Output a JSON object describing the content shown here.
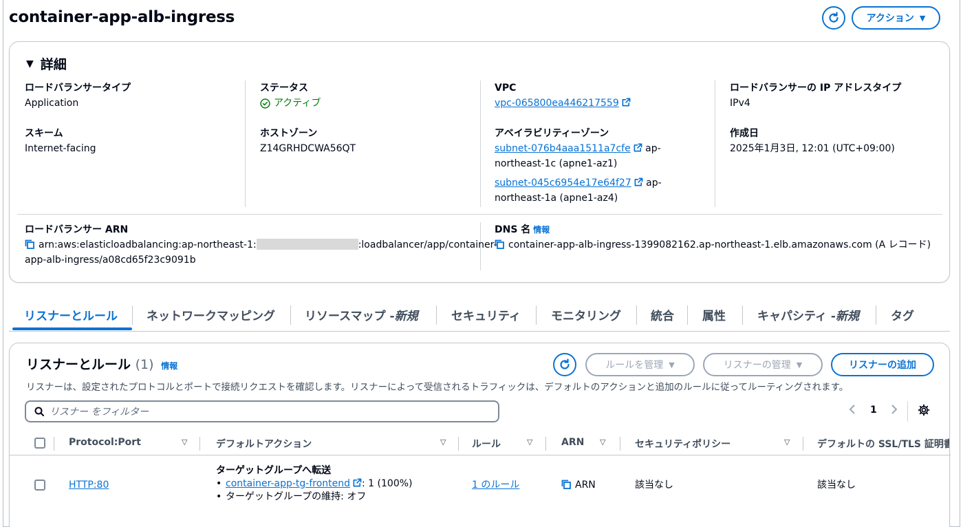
{
  "header": {
    "title": "container-app-alb-ingress",
    "actions_label": "アクション"
  },
  "details": {
    "heading": "詳細",
    "lb_type_label": "ロードバランサータイプ",
    "lb_type_value": "Application",
    "scheme_label": "スキーム",
    "scheme_value": "Internet-facing",
    "status_label": "ステータス",
    "status_value": "アクティブ",
    "hosted_zone_label": "ホストゾーン",
    "hosted_zone_value": "Z14GRHDCWA56QT",
    "vpc_label": "VPC",
    "vpc_value": "vpc-065800ea446217559",
    "az_label": "アベイラビリティーゾーン",
    "subnets": [
      {
        "id": "subnet-076b4aaa1511a7cfe",
        "suffix": " ap-",
        "zone": "northeast-1c (apne1-az1)"
      },
      {
        "id": "subnet-045c6954e17e64f27",
        "suffix": " ap-",
        "zone": "northeast-1a (apne1-az4)"
      }
    ],
    "ip_type_label": "ロードバランサーの IP アドレスタイプ",
    "ip_type_value": "IPv4",
    "created_label": "作成日",
    "created_value": "2025年1月3日, 12:01 (UTC+09:00)",
    "arn_label": "ロードバランサー ARN",
    "arn_part1": "arn:aws:elasticloadbalancing:ap-northeast-1:",
    "arn_part2": ":loadbalancer/app/container-",
    "arn_part3": "app-alb-ingress/a08cd65f23c9091b",
    "dns_label": "DNS 名",
    "info_label": "情報",
    "dns_value": "container-app-alb-ingress-1399082162.ap-northeast-1.elb.amazonaws.com (A レコード)"
  },
  "tabs": [
    {
      "label": "リスナーとルール",
      "new": ""
    },
    {
      "label": "ネットワークマッピング",
      "new": ""
    },
    {
      "label": "リソースマップ - ",
      "new": "新規"
    },
    {
      "label": "セキュリティ",
      "new": ""
    },
    {
      "label": "モニタリング",
      "new": ""
    },
    {
      "label": "統合",
      "new": ""
    },
    {
      "label": "属性",
      "new": ""
    },
    {
      "label": "キャパシティ - ",
      "new": "新規"
    },
    {
      "label": "タグ",
      "new": ""
    }
  ],
  "listeners": {
    "title": "リスナーとルール",
    "count": "(1)",
    "info_label": "情報",
    "manage_rules_label": "ルールを管理",
    "manage_listener_label": "リスナーの管理",
    "add_listener_label": "リスナーの追加",
    "description": "リスナーは、設定されたプロトコルとポートで接続リクエストを確認します。リスナーによって受信されるトラフィックは、デフォルトのアクションと追加のルールに従ってルーティングされます。",
    "filter_placeholder": "リスナー をフィルター",
    "page": "1",
    "columns": [
      "Protocol:Port",
      "デフォルトアクション",
      "ルール",
      "ARN",
      "セキュリティポリシー",
      "デフォルトの SSL/TLS 証明書"
    ],
    "row": {
      "protocol_port": "HTTP:80",
      "action_title": "ターゲットグループへ転送",
      "action_tg": "container-app-tg-frontend",
      "action_tg_weight": ": 1 (100%)",
      "action_stickiness": "ターゲットグループの維持: オフ",
      "rules": "1 のルール",
      "arn": "ARN",
      "security_policy": "該当なし",
      "ssl_cert": "該当なし"
    }
  },
  "colors": {
    "accent": "#0972d3",
    "success": "#037f0c",
    "border": "#c6c6cd"
  }
}
